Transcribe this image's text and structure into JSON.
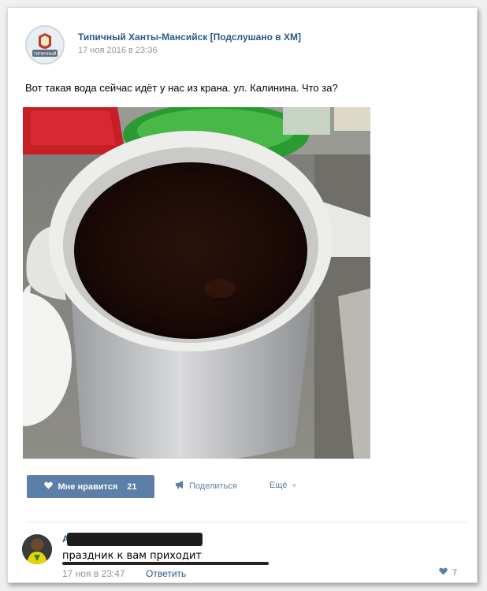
{
  "post": {
    "group_name": "Типичный Ханты-Мансийск [Подслушано в ХМ]",
    "time": "17 ноя 2016 в 23:36",
    "text": "Вот такая вода сейчас идёт у нас из крана. ул. Калинина. Что за?",
    "avatar_text": "ТИПИЧНЫЙ"
  },
  "actions": {
    "like_label": "Мне нравится",
    "like_count": "21",
    "share_label": "Поделиться",
    "more_label": "Ещё"
  },
  "comment": {
    "author": "А",
    "text": "праздник к вам приходит",
    "time": "17 ноя в 23:47",
    "reply_label": "Ответить",
    "likes": "7"
  },
  "colors": {
    "link": "#2a5885",
    "button": "#5b7fa6"
  }
}
